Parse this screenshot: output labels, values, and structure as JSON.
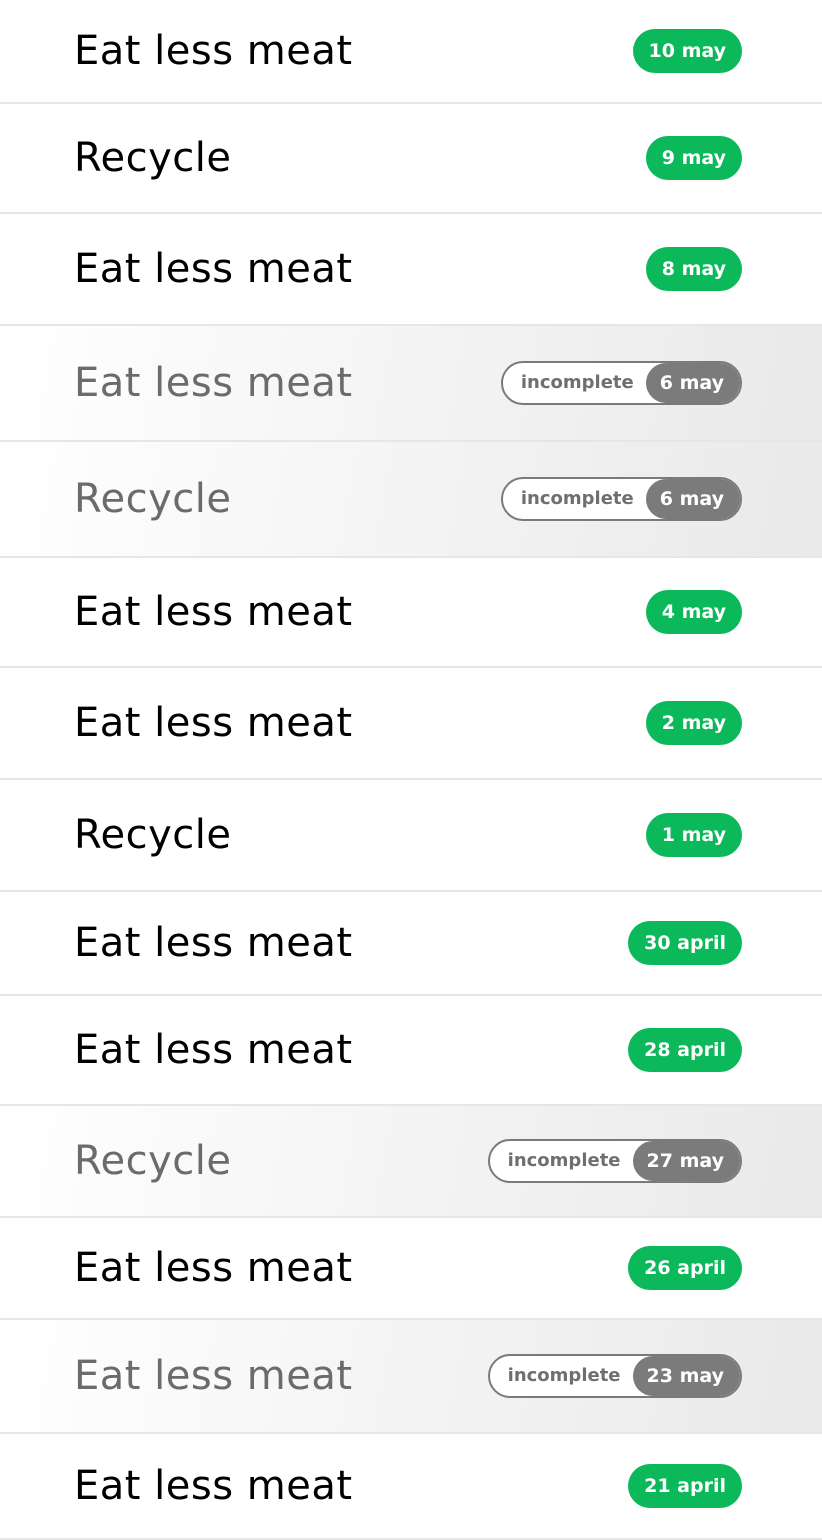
{
  "items": [
    {
      "title": "Eat less meat",
      "date": "10 may",
      "status": "complete"
    },
    {
      "title": "Recycle",
      "date": "9 may",
      "status": "complete"
    },
    {
      "title": "Eat less meat",
      "date": "8 may",
      "status": "complete"
    },
    {
      "title": "Eat less meat",
      "date": "6 may",
      "status": "incomplete",
      "status_label": "incomplete"
    },
    {
      "title": "Recycle",
      "date": "6 may",
      "status": "incomplete",
      "status_label": "incomplete"
    },
    {
      "title": "Eat less meat",
      "date": "4 may",
      "status": "complete"
    },
    {
      "title": "Eat less meat",
      "date": "2 may",
      "status": "complete"
    },
    {
      "title": "Recycle",
      "date": "1 may",
      "status": "complete"
    },
    {
      "title": "Eat less meat",
      "date": "30 april",
      "status": "complete"
    },
    {
      "title": "Eat less meat",
      "date": "28 april",
      "status": "complete"
    },
    {
      "title": "Recycle",
      "date": "27 may",
      "status": "incomplete",
      "status_label": "incomplete"
    },
    {
      "title": "Eat less meat",
      "date": "26 april",
      "status": "complete"
    },
    {
      "title": "Eat less meat",
      "date": "23 may",
      "status": "incomplete",
      "status_label": "incomplete"
    },
    {
      "title": "Eat less meat",
      "date": "21 april",
      "status": "complete"
    }
  ],
  "colors": {
    "complete_badge": "#0cb95a",
    "incomplete_badge": "#7b7b7b",
    "divider": "#e6e6e6"
  }
}
